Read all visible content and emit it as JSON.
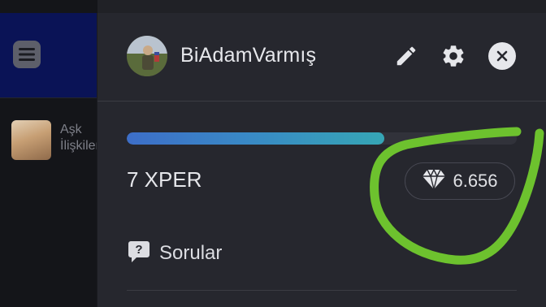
{
  "background_app": {
    "menu_icon": "hamburger-menu-icon",
    "list_item": {
      "label": "Aşk İlişkileri"
    }
  },
  "drawer": {
    "user": {
      "name": "BiAdamVarmış"
    },
    "actions": {
      "edit_icon": "pencil-icon",
      "settings_icon": "gear-icon",
      "close_icon": "close-icon"
    },
    "progress": {
      "fraction": 0.66
    },
    "xper": {
      "label": "7 XPER"
    },
    "gems": {
      "icon": "diamond-icon",
      "value": "6.656"
    },
    "menu": [
      {
        "icon": "question-bubble-icon",
        "label": "Sorular"
      }
    ]
  },
  "colors": {
    "drawer_bg": "#26272e",
    "header_blue": "#0a1356",
    "progress_start": "#3d6ec8",
    "progress_end": "#36a6b5",
    "annotation_green": "#6dc22e"
  }
}
